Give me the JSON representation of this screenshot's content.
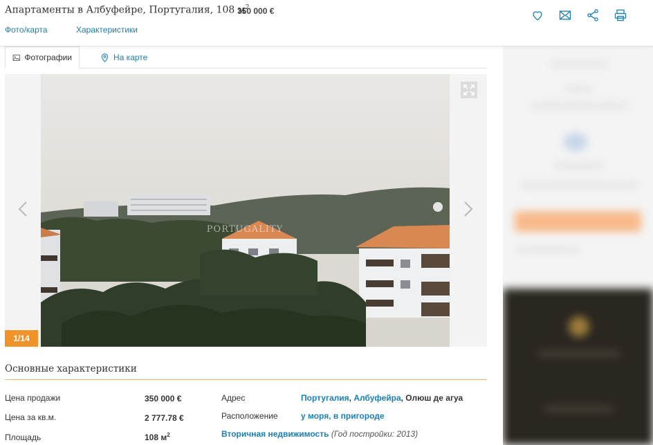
{
  "header": {
    "title": "Апартаменты в Албуфейре, Португалия, 108 м",
    "title_sup": "2",
    "price": "350 000 €",
    "links": [
      "Фото/карта",
      "Характеристики"
    ],
    "actions": [
      {
        "name": "favorite",
        "icon": "heart-icon"
      },
      {
        "name": "email",
        "icon": "envelope-icon"
      },
      {
        "name": "share",
        "icon": "share-icon"
      },
      {
        "name": "print",
        "icon": "printer-icon"
      }
    ]
  },
  "tabs": {
    "photos": "Фотографии",
    "map": "На карте"
  },
  "gallery": {
    "counter": "1/14",
    "watermark": "PORTUGALITY"
  },
  "characteristics": {
    "title": "Основные характеристики",
    "left": [
      {
        "label": "Цена продажи",
        "value": "350 000 €"
      },
      {
        "label": "Цена за кв.м.",
        "value": "2 777.78 €"
      },
      {
        "label": "Площадь",
        "value": "108 м",
        "sup": "2"
      }
    ],
    "address": {
      "label": "Адрес",
      "country": "Португалия",
      "sep1": ", ",
      "city": "Албуфейра",
      "sep2": ", ",
      "place": "Олюш де агуа"
    },
    "location": {
      "label": "Расположение",
      "a": "у моря",
      "sep": ", ",
      "b": "в пригороде"
    },
    "type": {
      "link": "Вторичная недвижимость",
      "note": " (Год постройки: 2013)"
    }
  },
  "colors": {
    "accent": "#1a7fb8",
    "counter_bg": "#f0932b",
    "divider": "#e8b774"
  }
}
